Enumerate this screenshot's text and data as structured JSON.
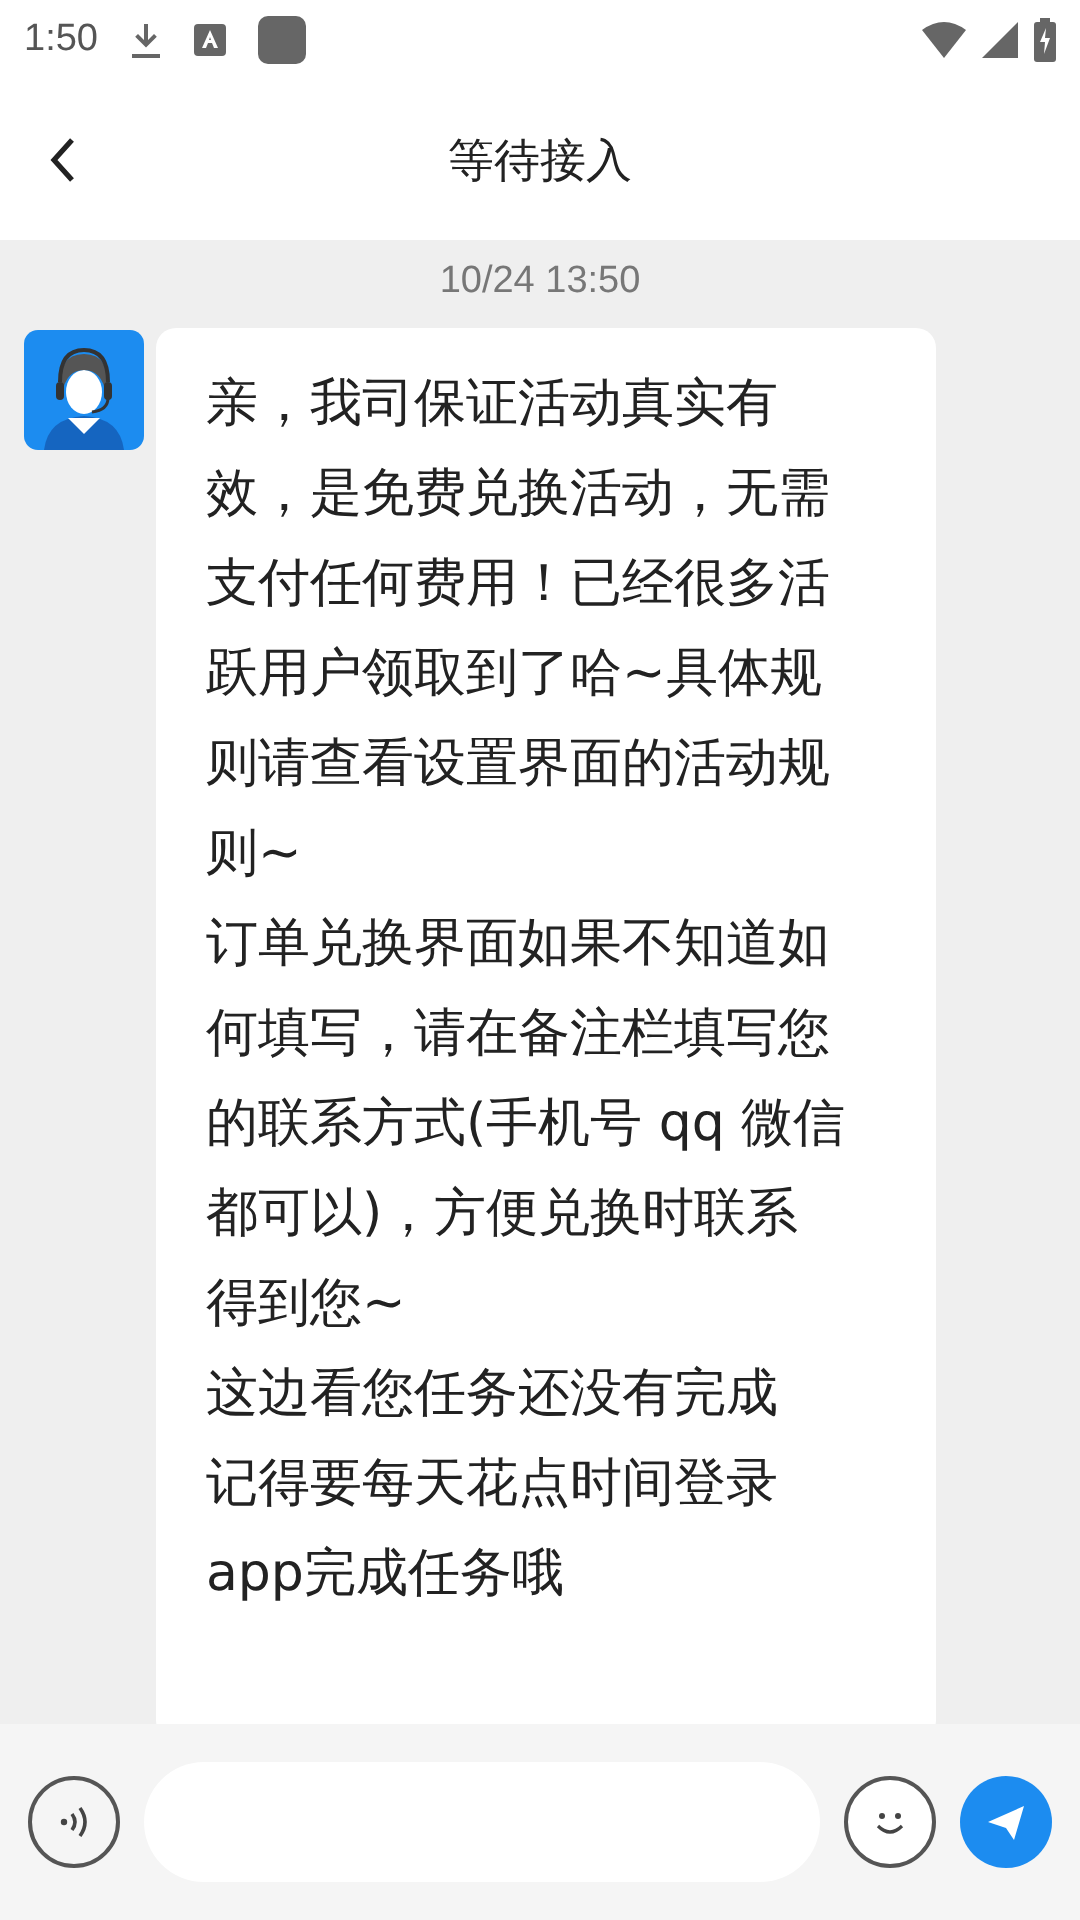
{
  "status_bar": {
    "time": "1:50"
  },
  "header": {
    "title": "等待接入"
  },
  "chat": {
    "timestamp": "10/24 13:50",
    "messages": [
      {
        "kind": "agent",
        "paragraphs": [
          "亲，我司保证活动真实有效，是免费兑换活动，无需支付任何费用！已经很多活跃用户领取到了哈~具体规则请查看设置界面的活动规则~",
          "订单兑换界面如果不知道如何填写，请在备注栏填写您的联系方式(手机号 qq 微信都可以)，方便兑换时联系得到您~",
          "这边看您任务还没有完成",
          "记得要每天花点时间登录app完成任务哦"
        ]
      }
    ]
  }
}
